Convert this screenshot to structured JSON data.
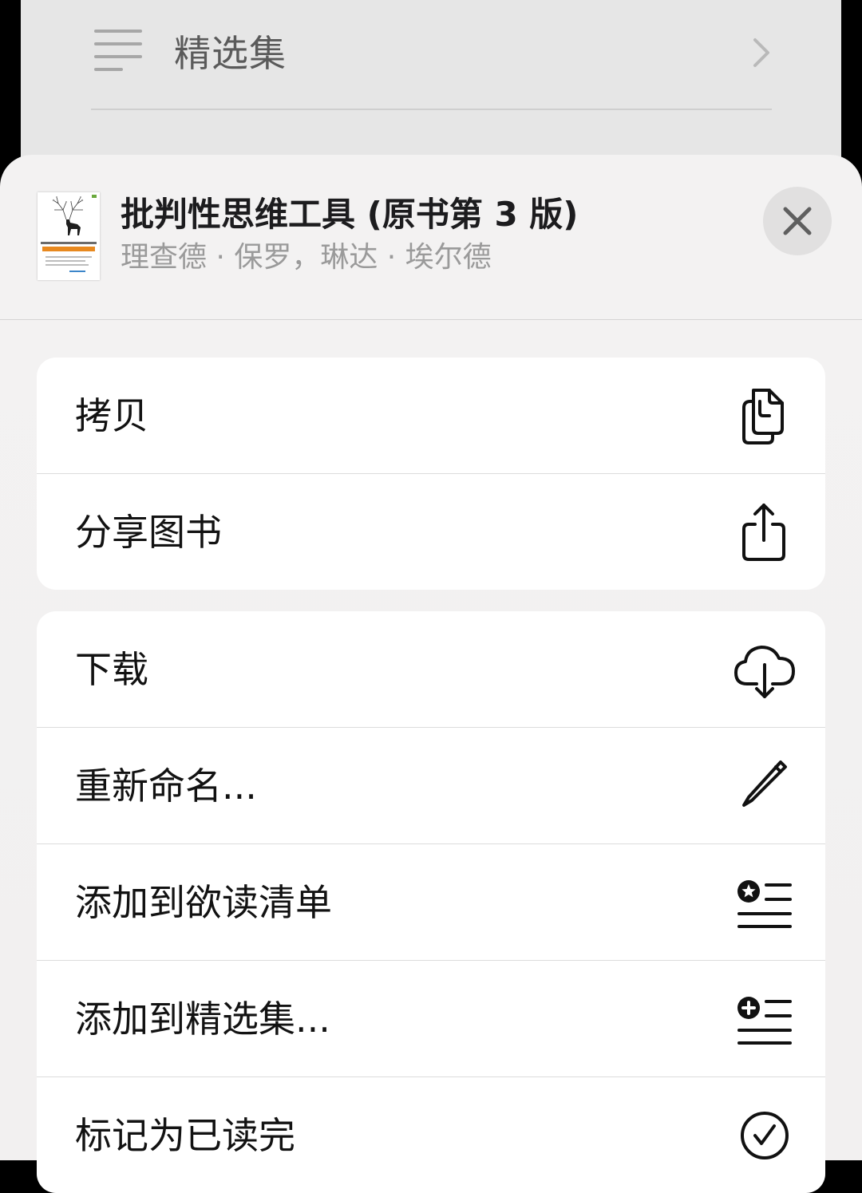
{
  "background": {
    "title": "精选集"
  },
  "sheet": {
    "book": {
      "title": "批判性思维工具 (原书第 3 版)",
      "author": "理查德 · 保罗，琳达 · 埃尔德"
    },
    "groups": [
      {
        "items": [
          {
            "label": "拷贝",
            "icon": "copy-icon"
          },
          {
            "label": "分享图书",
            "icon": "share-icon"
          }
        ]
      },
      {
        "items": [
          {
            "label": "下载",
            "icon": "cloud-download-icon"
          },
          {
            "label": "重新命名...",
            "icon": "pencil-icon"
          },
          {
            "label": "添加到欲读清单",
            "icon": "star-list-icon"
          },
          {
            "label": "添加到精选集...",
            "icon": "plus-list-icon"
          },
          {
            "label": "标记为已读完",
            "icon": "checkmark-circle-icon"
          }
        ]
      }
    ]
  }
}
